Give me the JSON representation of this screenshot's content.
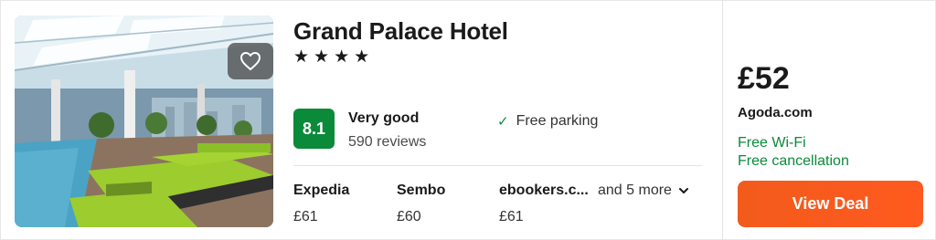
{
  "hotel": {
    "name": "Grand Palace Hotel",
    "stars": [
      "★",
      "★",
      "★",
      "★"
    ]
  },
  "rating": {
    "score": "8.1",
    "label": "Very good",
    "reviews": "590 reviews"
  },
  "amenity": {
    "icon": "check-icon",
    "label": "Free parking"
  },
  "providers": [
    {
      "name": "Expedia",
      "price": "£61"
    },
    {
      "name": "Sembo",
      "price": "£60"
    },
    {
      "name": "ebookers.c...",
      "price": "£61"
    }
  ],
  "more_link": "and 5 more",
  "deal": {
    "price": "£52",
    "provider": "Agoda.com",
    "perks": [
      "Free Wi-Fi",
      "Free cancellation"
    ],
    "button_label": "View Deal"
  },
  "colors": {
    "score_green": "#0b8a3a",
    "deal_orange": "#f25b1b",
    "perk_green": "#0b8a3a"
  },
  "icons": {
    "favorite": "heart-icon",
    "expand": "chevron-down-icon"
  }
}
